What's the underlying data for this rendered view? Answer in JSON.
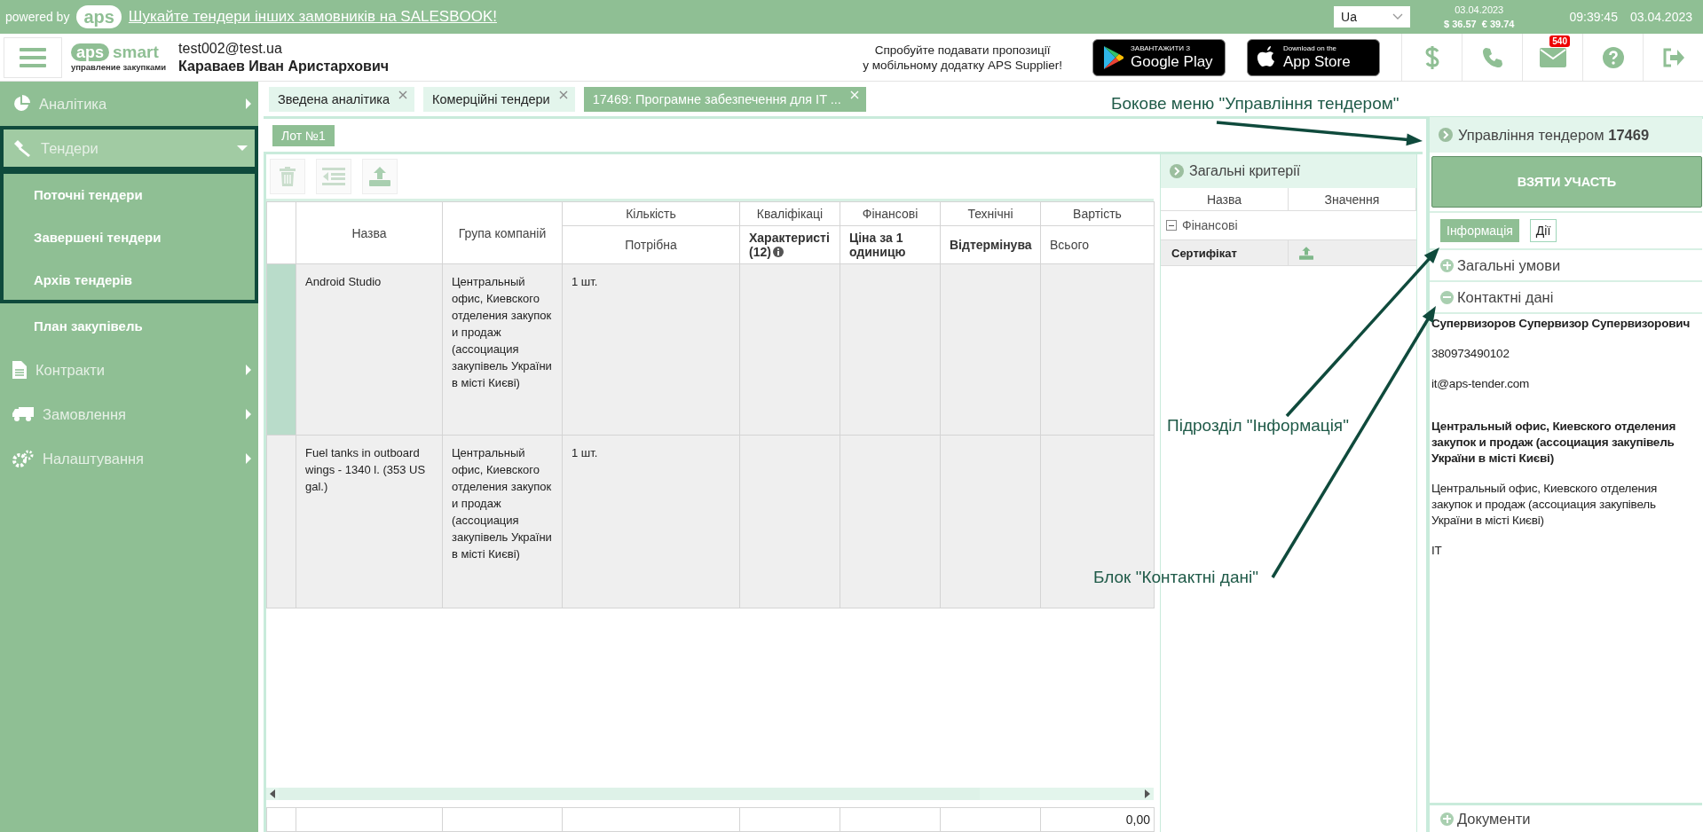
{
  "top_bar": {
    "powered_by": "powered by",
    "logo": "aps",
    "promo_link": "Шукайте тендери інших замовників на SALESBOOK!",
    "language": "Ua",
    "rates_date": "03.04.2023",
    "usd": "$ 36.57",
    "eur": "€ 39.74",
    "time": "09:39:45",
    "date": "03.04.2023"
  },
  "header": {
    "logo_mark": "aps",
    "logo_word": "smart",
    "logo_sub": "управление закупками",
    "email": "test002@test.ua",
    "user_name": "Караваев Иван Аристархович",
    "promo_lines": [
      "Спробуйте подавати пропозиції",
      "у мобільному додатку APS Supplier!"
    ],
    "stores": [
      {
        "kind": "google",
        "small": "ЗАВАНТАЖИТИ З",
        "big": "Google Play"
      },
      {
        "kind": "apple",
        "small": "Download on the",
        "big": "App Store"
      }
    ],
    "mail_badge": "540"
  },
  "sidebar": {
    "items": [
      {
        "label": "Аналітика",
        "expanded": false,
        "highlighted": false
      },
      {
        "label": "Тендери",
        "expanded": true,
        "highlighted": true,
        "children": [
          {
            "label": "Поточні тендери",
            "highlighted": true
          },
          {
            "label": "Завершені тендери",
            "highlighted": true
          },
          {
            "label": "Архів тендерів",
            "highlighted": true
          },
          {
            "label": "План закупівель",
            "highlighted": false
          }
        ]
      },
      {
        "label": "Контракти",
        "expanded": false,
        "highlighted": false
      },
      {
        "label": "Замовлення",
        "expanded": false,
        "highlighted": false
      },
      {
        "label": "Налаштування",
        "expanded": false,
        "highlighted": false
      }
    ]
  },
  "tabs": [
    {
      "label": "Зведена аналітика",
      "selected": false
    },
    {
      "label": "Комерційні тендери",
      "selected": false
    },
    {
      "label": "17469: Програмне забезпечення для IT ...",
      "selected": true
    }
  ],
  "lot_button": "Лот №1",
  "table": {
    "groups": [
      {
        "label": "Назва"
      },
      {
        "label": "Група компаній"
      },
      {
        "label": "Кількість",
        "sub": "Потрібна",
        "sub_bold": false
      },
      {
        "label": "Кваліфікаці",
        "sub": "Характеристі (12)",
        "sub_bold": true,
        "info": true
      },
      {
        "label": "Фінансові",
        "sub": "Ціна за 1 одиницю",
        "sub_bold": true
      },
      {
        "label": "Технічні",
        "sub": "Відтермінува",
        "sub_bold": true
      },
      {
        "label": "Вартість",
        "sub": "Всього",
        "sub_bold": false
      }
    ],
    "rows": [
      {
        "selected": true,
        "name": "Android Studio",
        "group": "Центральный офис, Киевского отделения закупок и продаж (ассоциация закупівель України в місті Києві)",
        "quantity": "1 шт."
      },
      {
        "selected": false,
        "name": "Fuel tanks in outboard wings - 1340 l. (353 US gal.)",
        "group": "Центральный офис, Киевского отделения закупок и продаж (ассоциация закупівель України в місті Києві)",
        "quantity": "1 шт."
      }
    ],
    "total": "0,00"
  },
  "criteria": {
    "title": "Загальні критерії",
    "columns": [
      "Назва",
      "Значення"
    ],
    "group": {
      "label": "Фінансові",
      "expanded": true
    },
    "rows": [
      {
        "name": "Сертифікат"
      }
    ]
  },
  "side_panel": {
    "title": "Управління тендером **17469**",
    "action_button": "ВЗЯТИ УЧАСТЬ",
    "subtabs": [
      {
        "label": "Інформація",
        "selected": true
      },
      {
        "label": "Дії",
        "selected": false
      }
    ],
    "sections": [
      {
        "label": "Загальні умови",
        "expanded": false
      },
      {
        "label": "Контактні дані",
        "expanded": true
      }
    ],
    "contact": [
      {
        "kind": "bold",
        "text": "Супервизоров Супервизор Супервизорович"
      },
      {
        "kind": "plain",
        "text": "380973490102"
      },
      {
        "kind": "plain",
        "text": "it@aps-tender.com"
      },
      {
        "kind": "bold",
        "text": "Центральный офис, Киевского отделения закупок и продаж (ассоциация закупівель України в місті Києві)"
      },
      {
        "kind": "plain",
        "text": "Центральный офис, Киевского отделения закупок и продаж (ассоциация закупівель України в місті Києві)"
      },
      {
        "kind": "plain",
        "text": "IT"
      }
    ],
    "bottom_section": {
      "label": "Документи",
      "expanded": false
    }
  },
  "annotations": [
    {
      "text": "Бокове меню \"Управління тендером\""
    },
    {
      "text": "Підрозділ \"Інформація\""
    },
    {
      "text": "Блок \"Контактні дані\""
    }
  ]
}
